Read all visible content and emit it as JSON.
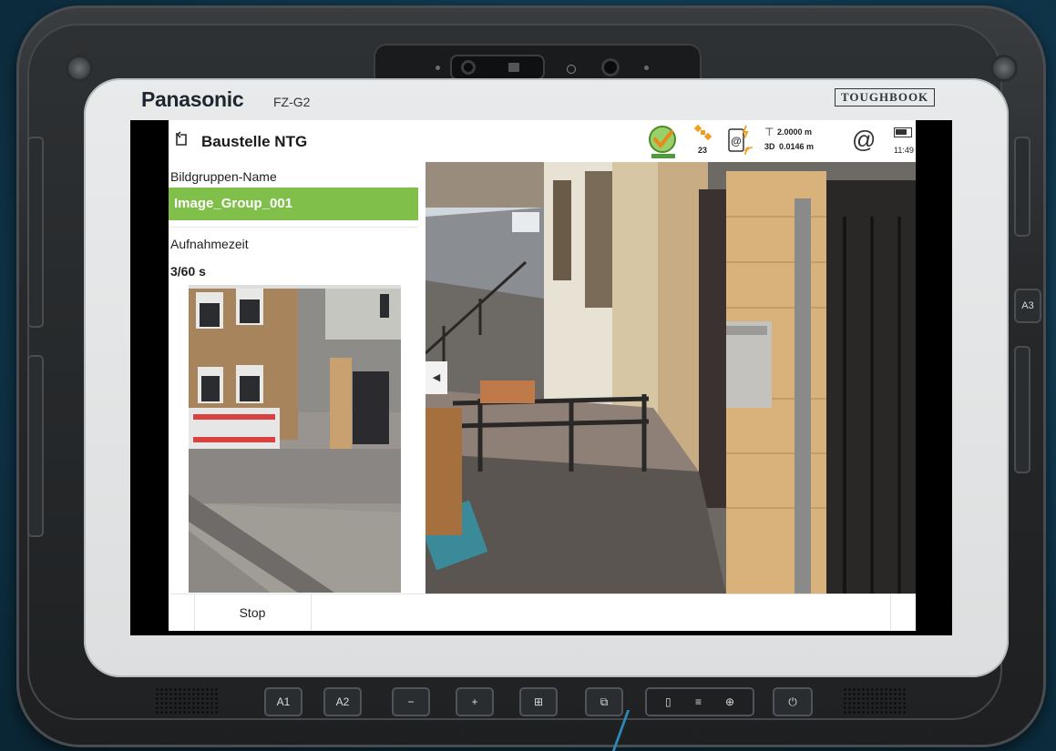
{
  "device": {
    "brand": "Panasonic",
    "model": "FZ-G2",
    "badge": "TOUGHBOOK",
    "side_button": "A3",
    "bottom_buttons": [
      "A1",
      "A2",
      "−",
      "+",
      "⊞",
      "⧉",
      "▯",
      "≡",
      "⊕",
      "⏻"
    ]
  },
  "header": {
    "title": "Baustelle NTG",
    "satellites": "23",
    "height_value": "2.0000 m",
    "precision_label": "3D",
    "precision_value": "0.0146 m",
    "time": "11:49"
  },
  "left_panel": {
    "group_name_label": "Bildgruppen-Name",
    "group_name_value": "Image_Group_001",
    "capture_time_label": "Aufnahmezeit",
    "capture_time_value": "3/60 s"
  },
  "footer": {
    "stop_label": "Stop"
  },
  "colors": {
    "accent_green": "#7fbf4a",
    "gnss_orange": "#f0a020",
    "background": "#123d53"
  }
}
